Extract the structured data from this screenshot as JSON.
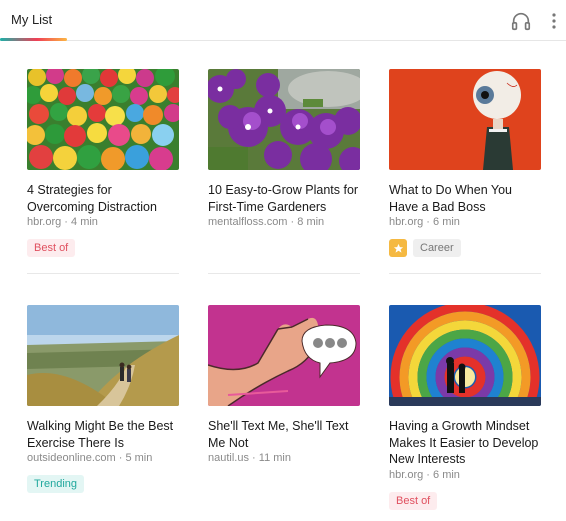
{
  "header": {
    "title": "My List",
    "listen_icon": "headphones-icon",
    "menu_icon": "more-vert-icon"
  },
  "colors": {
    "accent_start": "#1cb0a8",
    "accent_mid": "#ef4056",
    "accent_end": "#fcb643",
    "best_of": "#e0505f",
    "trending": "#20a89d",
    "favorite": "#f5b942"
  },
  "articles": [
    {
      "title": "4 Strategies for Overcoming Distraction",
      "source": "hbr.org",
      "read_time": "4 min",
      "tags": [
        "Best of"
      ],
      "favorite": false,
      "image": "colorful-balls"
    },
    {
      "title": "10 Easy-to-Grow Plants for First-Time Gardeners",
      "source": "mentalfloss.com",
      "read_time": "8 min",
      "tags": [],
      "favorite": false,
      "image": "purple-pansies"
    },
    {
      "title": "What to Do When You Have a Bad Boss",
      "source": "hbr.org",
      "read_time": "6 min",
      "tags": [
        "Career"
      ],
      "favorite": true,
      "image": "eyeball-man"
    },
    {
      "title": "Walking Might Be the Best Exercise There Is",
      "source": "outsideonline.com",
      "read_time": "5 min",
      "tags": [
        "Trending"
      ],
      "favorite": false,
      "image": "hill-walkers"
    },
    {
      "title": "She'll Text Me, She'll Text Me Not",
      "source": "nautil.us",
      "read_time": "11 min",
      "tags": [],
      "favorite": false,
      "image": "hand-speech-bubble"
    },
    {
      "title": "Having a Growth Mindset Makes It Easier to Develop New Interests",
      "source": "hbr.org",
      "read_time": "6 min",
      "tags": [
        "Best of"
      ],
      "favorite": false,
      "image": "hot-air-balloon"
    }
  ]
}
